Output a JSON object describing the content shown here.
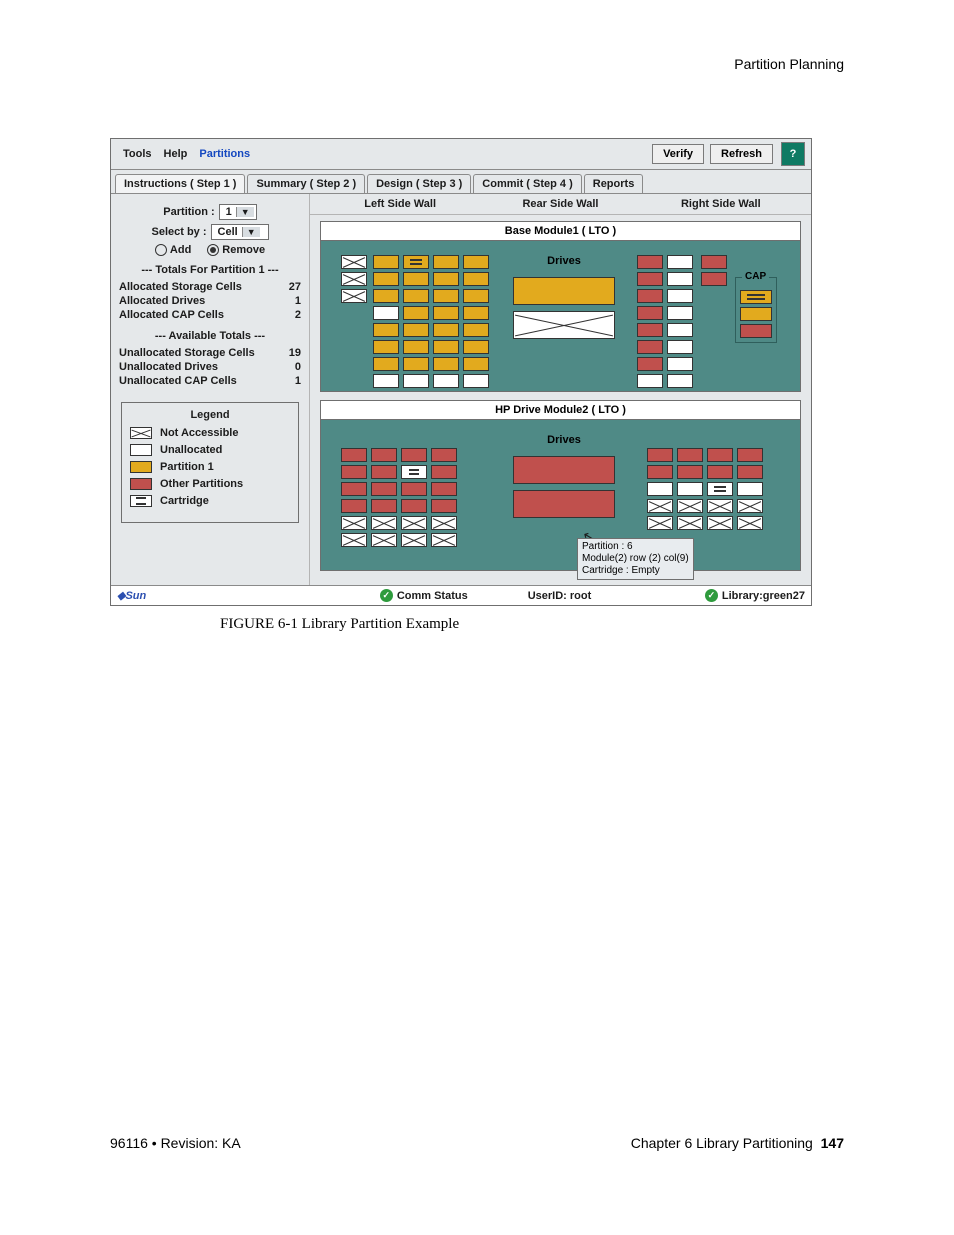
{
  "header": {
    "section": "Partition Planning"
  },
  "menubar": {
    "items": [
      "Tools",
      "Help",
      "Partitions"
    ],
    "active_index": 2,
    "buttons": {
      "verify": "Verify",
      "refresh": "Refresh"
    }
  },
  "tabs": [
    "Instructions ( Step 1 )",
    "Summary ( Step 2 )",
    "Design ( Step 3 )",
    "Commit ( Step 4 )",
    "Reports"
  ],
  "sidebar": {
    "partition_label": "Partition :",
    "partition_value": "1",
    "selectby_label": "Select by :",
    "selectby_value": "Cell",
    "add_label": "Add",
    "remove_label": "Remove",
    "totals_header": "--- Totals For Partition 1 ---",
    "totals": [
      {
        "label": "Allocated Storage Cells",
        "value": "27"
      },
      {
        "label": "Allocated Drives",
        "value": "1"
      },
      {
        "label": "Allocated CAP Cells",
        "value": "2"
      }
    ],
    "avail_header": "--- Available Totals ---",
    "avail": [
      {
        "label": "Unallocated Storage Cells",
        "value": "19"
      },
      {
        "label": "Unallocated Drives",
        "value": "0"
      },
      {
        "label": "Unallocated CAP Cells",
        "value": "1"
      }
    ],
    "legend": {
      "title": "Legend",
      "items": [
        "Not Accessible",
        "Unallocated",
        "Partition  1",
        "Other Partitions",
        "Cartridge"
      ]
    }
  },
  "walls": {
    "left": "Left Side Wall",
    "rear": "Rear Side Wall",
    "right": "Right Side Wall"
  },
  "modules": [
    {
      "title": "Base Module1   ( LTO )",
      "drives_label": "Drives",
      "cap_label": "CAP"
    },
    {
      "title": "HP Drive Module2   ( LTO )",
      "drives_label": "Drives"
    }
  ],
  "tooltip": {
    "lines": [
      "Partition : 6",
      "Module(2) row (2) col(9)",
      "Cartridge : Empty"
    ]
  },
  "status": {
    "logo": "Sun",
    "comm": "Comm Status",
    "user": "UserID: root",
    "library": "Library:green27"
  },
  "caption": "FIGURE 6-1 Library Partition Example",
  "footer": {
    "left": "96116 • Revision: KA",
    "right_label": "Chapter 6 Library Partitioning",
    "right_page": "147"
  }
}
